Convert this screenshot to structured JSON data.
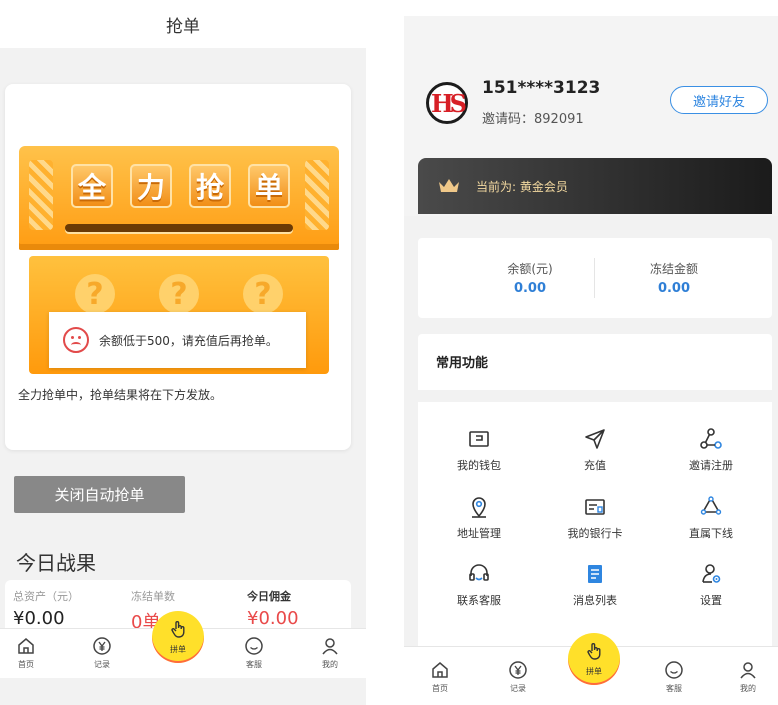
{
  "left": {
    "title": "抢单",
    "machine_tiles": [
      "全",
      "力",
      "抢",
      "单"
    ],
    "machine_question": "?",
    "toast_text": "余额低于500，请充值后再抢单。",
    "card_note": "全力抢单中，抢单结果将在下方发放。",
    "stop_button": "关闭自动抢单",
    "today_title": "今日战果",
    "stats": [
      {
        "label": "总资产（元）",
        "value": "¥0.00",
        "color": "#222222"
      },
      {
        "label": "冻结单数",
        "value": "0单",
        "color": "#e94a4a"
      },
      {
        "label": "今日佣金",
        "value": "¥0.00",
        "color": "#e94a4a"
      }
    ],
    "tabs": [
      "首页",
      "记录",
      "拼单",
      "客服",
      "我的"
    ]
  },
  "right": {
    "logo_text": "HS",
    "phone": "151****3123",
    "invite_code": "邀请码：892091",
    "invite_button": "邀请好友",
    "vip_text": "当前为: 黄金会员",
    "balance": {
      "label": "余额(元)",
      "value": "0.00"
    },
    "frozen": {
      "label": "冻结金额",
      "value": "0.00"
    },
    "functions_title": "常用功能",
    "functions": [
      {
        "label": "我的钱包",
        "icon": "wallet-icon"
      },
      {
        "label": "充值",
        "icon": "send-icon"
      },
      {
        "label": "邀请注册",
        "icon": "share-icon"
      },
      {
        "label": "地址管理",
        "icon": "location-icon"
      },
      {
        "label": "我的银行卡",
        "icon": "bank-card-icon"
      },
      {
        "label": "直属下线",
        "icon": "team-icon"
      },
      {
        "label": "联系客服",
        "icon": "headset-icon"
      },
      {
        "label": "消息列表",
        "icon": "message-list-icon"
      },
      {
        "label": "设置",
        "icon": "settings-icon"
      }
    ],
    "tabs": [
      "首页",
      "记录",
      "拼单",
      "客服",
      "我的"
    ]
  },
  "colors": {
    "accent_blue": "#2f86e0",
    "accent_orange": "#ff9c12",
    "fab_yellow": "#ffe02a",
    "warn_red": "#e94a4a",
    "vip_gold": "#f3d9a0"
  }
}
